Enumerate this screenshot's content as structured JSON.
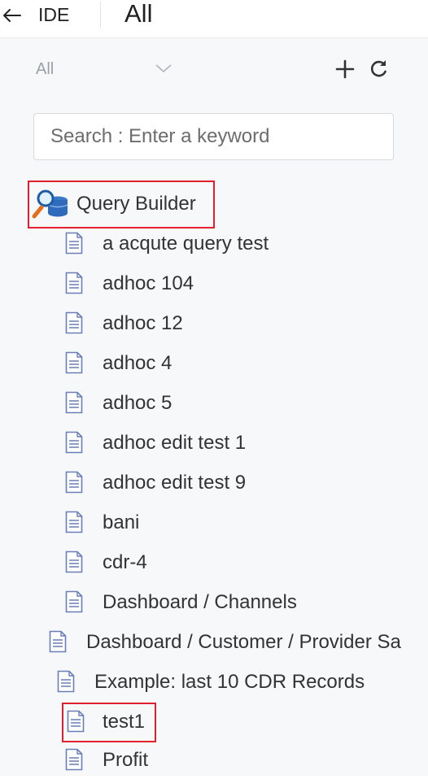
{
  "header": {
    "ide_label": "IDE",
    "title": "All"
  },
  "toolbar": {
    "filter_value": "All"
  },
  "search": {
    "placeholder": "Search : Enter a keyword"
  },
  "tree": {
    "root": {
      "label": "Query Builder"
    },
    "children": [
      {
        "label": "a acqute query test"
      },
      {
        "label": "adhoc 104"
      },
      {
        "label": "adhoc 12"
      },
      {
        "label": "adhoc 4"
      },
      {
        "label": "adhoc 5"
      },
      {
        "label": "adhoc edit test 1"
      },
      {
        "label": "adhoc edit test 9"
      },
      {
        "label": "bani"
      },
      {
        "label": "cdr-4"
      },
      {
        "label": "Dashboard / Channels"
      },
      {
        "label": "Dashboard / Customer / Provider Sa"
      },
      {
        "label": "Example: last 10 CDR Records"
      },
      {
        "label": "test1"
      },
      {
        "label": "Profit"
      }
    ]
  },
  "colors": {
    "highlight": "#e0202e",
    "doc_icon": "#6a7fb5",
    "panel_bg": "#f7f8fa"
  }
}
